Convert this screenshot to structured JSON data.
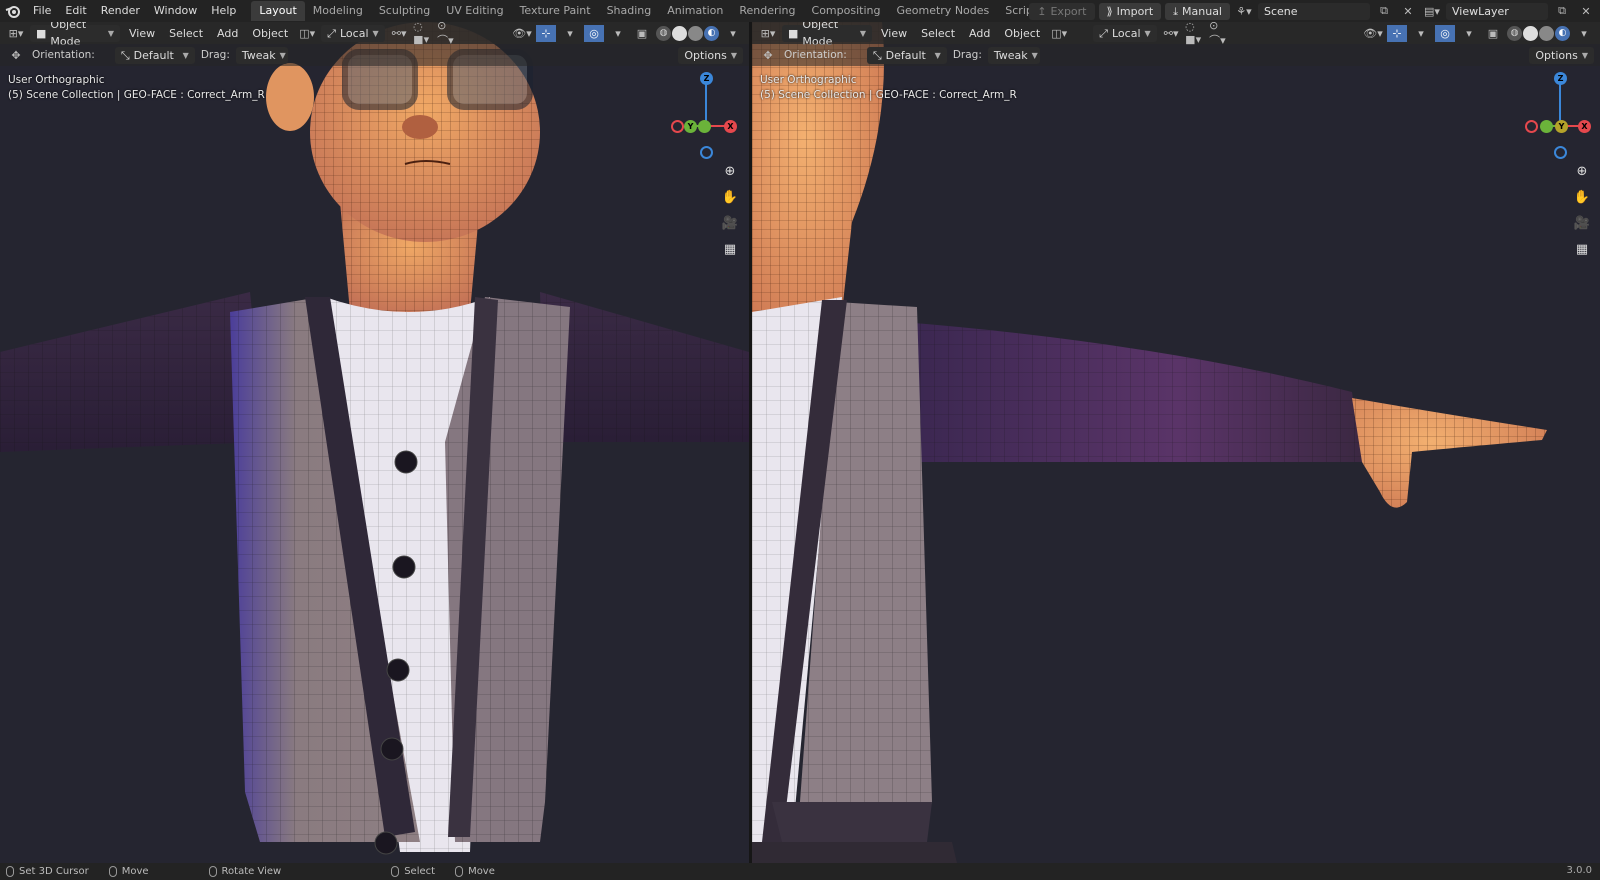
{
  "menu": {
    "items": [
      "File",
      "Edit",
      "Render",
      "Window",
      "Help"
    ]
  },
  "workspaces": {
    "tabs": [
      "Layout",
      "Modeling",
      "Sculpting",
      "UV Editing",
      "Texture Paint",
      "Shading",
      "Animation",
      "Rendering",
      "Compositing",
      "Geometry Nodes",
      "Scripting"
    ],
    "active": "Layout",
    "add": "+"
  },
  "topright": {
    "export": "Export",
    "import": "Import",
    "manual": "Manual",
    "scene": "Scene",
    "viewlayer": "ViewLayer"
  },
  "viewport_left": {
    "mode": "Object Mode",
    "menus": [
      "View",
      "Select",
      "Add",
      "Object"
    ],
    "transform": "Local",
    "orientation_label": "Orientation:",
    "orientation_value": "Default",
    "drag_label": "Drag:",
    "drag_value": "Tweak",
    "options": "Options",
    "view_name": "User Orthographic",
    "collection": "(5) Scene Collection | GEO-FACE : Correct_Arm_R"
  },
  "viewport_right": {
    "mode": "Object Mode",
    "menus": [
      "View",
      "Select",
      "Add",
      "Object"
    ],
    "transform": "Local",
    "orientation_label": "Orientation:",
    "orientation_value": "Default",
    "drag_label": "Drag:",
    "drag_value": "Tweak",
    "options": "Options",
    "view_name": "User Orthographic",
    "collection": "(5) Scene Collection | GEO-FACE : Correct_Arm_R"
  },
  "gizmo": {
    "z": "Z",
    "y": "Y",
    "x": "X"
  },
  "status": {
    "items": [
      "Set 3D Cursor",
      "Move",
      "Rotate View",
      "Select",
      "Move"
    ],
    "version": "3.0.0"
  },
  "colors": {
    "accent": "#4772b3",
    "axis_x": "#e5484d",
    "axis_y": "#6bb33a",
    "axis_z": "#3b87d9",
    "background": "#252530"
  }
}
